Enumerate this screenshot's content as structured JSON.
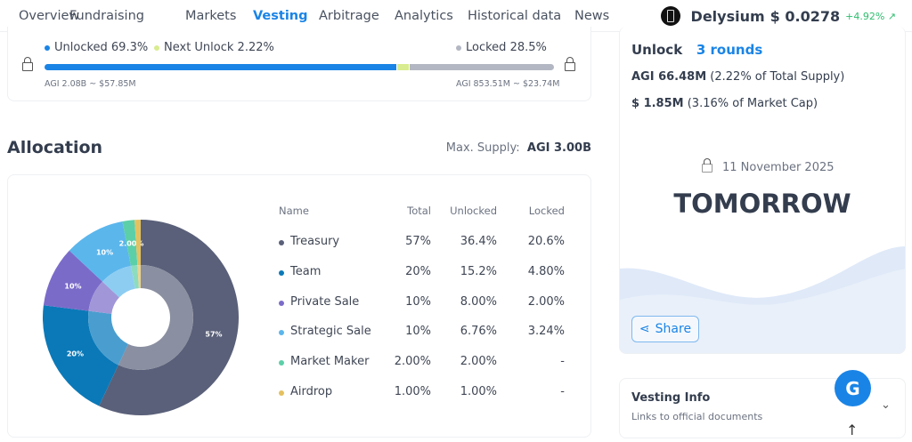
{
  "nav": {
    "tabs": [
      "Overview",
      "Fundraising",
      "Markets",
      "Vesting",
      "Arbitrage",
      "Analytics",
      "Historical data",
      "News"
    ],
    "active": "Vesting"
  },
  "coin": {
    "name": "Delysium",
    "price": "$ 0.0278",
    "change": "+4.92%",
    "change_icon": "arrow-up-right-icon"
  },
  "progress": {
    "unlocked_label": "Unlocked 69.3%",
    "next_label": "Next Unlock 2.22%",
    "locked_label": "Locked 28.5%",
    "unlocked_pct": 69.3,
    "next_pct": 2.22,
    "locked_pct": 28.5,
    "unlocked_amount": "AGI 2.08B ~ $57.85M",
    "locked_amount": "AGI 853.51M ~ $23.74M",
    "colors": {
      "unlocked": "#1a84e6",
      "next": "#d9ec8f",
      "locked": "#b3b7c3"
    }
  },
  "allocation": {
    "title": "Allocation",
    "max_supply_label": "Max. Supply:",
    "max_supply_value": "AGI 3.00B",
    "headers": [
      "Name",
      "Total",
      "Unlocked",
      "Locked"
    ],
    "rows": [
      {
        "name": "Treasury",
        "total": "57%",
        "unlocked": "36.4%",
        "locked": "20.6%",
        "value": 57,
        "color": "#5a6079",
        "inner": "#8a8fa1"
      },
      {
        "name": "Team",
        "total": "20%",
        "unlocked": "15.2%",
        "locked": "4.80%",
        "value": 20,
        "color": "#0b79b8",
        "inner": "#4a9ecf"
      },
      {
        "name": "Private Sale",
        "total": "10%",
        "unlocked": "8.00%",
        "locked": "2.00%",
        "value": 10,
        "color": "#7b6bc9",
        "inner": "#a197d8"
      },
      {
        "name": "Strategic Sale",
        "total": "10%",
        "unlocked": "6.76%",
        "locked": "3.24%",
        "value": 10,
        "color": "#5bb6ec",
        "inner": "#8dcdf2"
      },
      {
        "name": "Market Maker",
        "total": "2.00%",
        "unlocked": "2.00%",
        "locked": "-",
        "value": 2,
        "color": "#5ccfa9",
        "inner": "#8cdcc0"
      },
      {
        "name": "Airdrop",
        "total": "1.00%",
        "unlocked": "1.00%",
        "locked": "-",
        "value": 1,
        "color": "#e4c160",
        "inner": "#ecd38f"
      }
    ],
    "slice_labels": [
      "57%",
      "20%",
      "10%",
      "10%",
      "2.00%"
    ]
  },
  "unlock": {
    "title": "Unlock",
    "rounds": "3 rounds",
    "amount_bold": "AGI 66.48M",
    "amount_rest": "(2.22% of Total Supply)",
    "usd_bold": "$ 1.85M",
    "usd_rest": "(3.16% of Market Cap)",
    "date": "11 November 2025",
    "when": "TOMORROW",
    "share": "Share"
  },
  "vesting_info": {
    "title": "Vesting Info",
    "subtitle": "Links to official documents"
  }
}
